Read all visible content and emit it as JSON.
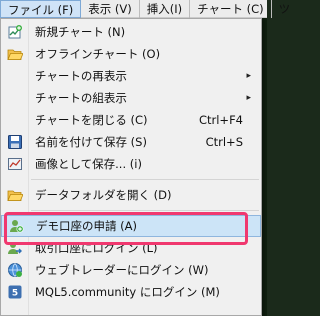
{
  "menubar": {
    "items": [
      "ファイル (F)",
      "表示 (V)",
      "挿入(I)",
      "チャート (C)",
      "ツ"
    ]
  },
  "menu": {
    "items": [
      {
        "label": "新規チャート (N)",
        "shortcut": "",
        "icon": "new-chart-icon"
      },
      {
        "label": "オフラインチャート (O)",
        "shortcut": "",
        "icon": "open-folder-icon"
      },
      {
        "label": "チャートの再表示",
        "shortcut": "",
        "submenu": "▸"
      },
      {
        "label": "チャートの組表示",
        "shortcut": "",
        "submenu": "▸"
      },
      {
        "label": "チャートを閉じる (C)",
        "shortcut": "Ctrl+F4"
      },
      {
        "label": "名前を付けて保存 (S)",
        "shortcut": "Ctrl+S",
        "icon": "save-icon"
      },
      {
        "label": "画像として保存... (i)",
        "shortcut": "",
        "icon": "image-save-icon"
      },
      {
        "label": "データフォルダを開く (D)",
        "shortcut": "",
        "icon": "folder-icon"
      },
      {
        "label": "デモ口座の申請 (A)",
        "shortcut": "",
        "icon": "demo-account-icon"
      },
      {
        "label": "取引口座にログイン (L)",
        "shortcut": "",
        "icon": "login-icon"
      },
      {
        "label": "ウェブトレーダーにログイン (W)",
        "shortcut": "",
        "icon": "web-trader-icon"
      },
      {
        "label": "MQL5.community にログイン (M)",
        "shortcut": "",
        "icon": "mql5-icon"
      }
    ]
  },
  "colors": {
    "highlight_border": "#f0386f",
    "selected_bg": "#cce4f7"
  }
}
